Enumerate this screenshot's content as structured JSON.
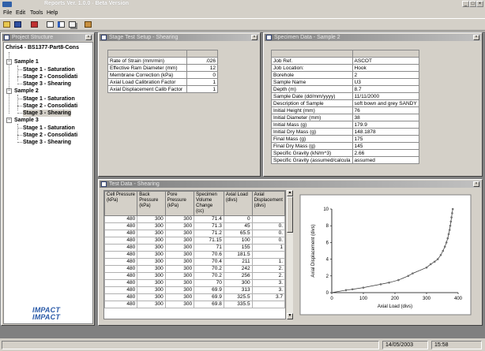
{
  "window": {
    "title": "Reports Ver. 1.0.0 - Beta Version",
    "min": "_",
    "max": "□",
    "close": "×"
  },
  "menu": [
    "File",
    "Edit",
    "Tools",
    "Help"
  ],
  "project": {
    "title": "Project Structure",
    "root": "Chris4 - BS1377-Part8-Cons",
    "samples": [
      {
        "label": "Sample 1",
        "stages": [
          "Stage 1 - Saturation",
          "Stage 2 - Consolidati",
          "Stage 3 - Shearing"
        ]
      },
      {
        "label": "Sample 2",
        "stages": [
          "Stage 1 - Saturation",
          "Stage 2 - Consolidati",
          "Stage 3 - Shearing"
        ]
      },
      {
        "label": "Sample 3",
        "stages": [
          "Stage 1 - Saturation",
          "Stage 2 - Consolidati",
          "Stage 3 - Shearing"
        ]
      }
    ],
    "logo": [
      "IMPACT",
      "IMPACT"
    ]
  },
  "setup": {
    "title": "Stage Test Setup - Shearing",
    "rows": [
      [
        "Rate of Strain (mm/min)",
        ".026"
      ],
      [
        "Effective Ram Diameter (mm)",
        "12"
      ],
      [
        "Membrane Correction (kPa)",
        "0"
      ],
      [
        "Axial Load Calibration Factor",
        "1"
      ],
      [
        "Axial Displacement Calib Factor",
        "1"
      ]
    ]
  },
  "specimen": {
    "title": "Specimen Data - Sample 2",
    "rows": [
      [
        "Job Ref.",
        "ASCOT"
      ],
      [
        "Job Location:",
        "Hook"
      ],
      [
        "Borehole",
        "2"
      ],
      [
        "Sample Name",
        "U3"
      ],
      [
        "Depth (m)",
        "8.7"
      ],
      [
        "Sample Date (dd/mm/yyyy)",
        "11/11/2000"
      ],
      [
        "Description of Sample",
        "soft bown and grey SANDY"
      ],
      [
        "Initial Height (mm)",
        "76"
      ],
      [
        "Initial Diameter (mm)",
        "38"
      ],
      [
        "Initial Mass (g)",
        "179.9"
      ],
      [
        "Initial Dry Mass (g)",
        "148.1878"
      ],
      [
        "Final Mass (g)",
        "175"
      ],
      [
        "Final Dry Mass (g)",
        "145"
      ],
      [
        "Specific Gravity (kN/m^3)",
        "2.66"
      ],
      [
        "Specific Gravity (assumed/calcula",
        "assumed"
      ]
    ]
  },
  "testdata": {
    "title": "Test Data - Shearing",
    "columns": [
      "Cell Pressure (kPa)",
      "Back Pressure (kPa)",
      "Pore Pressure (kPa)",
      "Specimen Volume Change (cc)",
      "Axial Load (divs)",
      "Axial Displacement (divs)"
    ],
    "rows": [
      [
        "480",
        "300",
        "300",
        "71.4",
        "0",
        ""
      ],
      [
        "480",
        "300",
        "300",
        "71.3",
        "45",
        "0."
      ],
      [
        "480",
        "300",
        "300",
        "71.2",
        "65.5",
        "0."
      ],
      [
        "480",
        "300",
        "300",
        "71.15",
        "100",
        "0."
      ],
      [
        "480",
        "300",
        "300",
        "71",
        "155",
        "1"
      ],
      [
        "480",
        "300",
        "300",
        "70.6",
        "181.5",
        ""
      ],
      [
        "480",
        "300",
        "300",
        "70.4",
        "211",
        "1."
      ],
      [
        "480",
        "300",
        "300",
        "70.2",
        "242",
        "2."
      ],
      [
        "480",
        "300",
        "300",
        "70.2",
        "256",
        "2."
      ],
      [
        "480",
        "300",
        "300",
        "70",
        "300",
        "3."
      ],
      [
        "480",
        "300",
        "300",
        "69.9",
        "313",
        "3."
      ],
      [
        "480",
        "300",
        "300",
        "69.9",
        "325.5",
        "3.7"
      ],
      [
        "480",
        "300",
        "300",
        "69.8",
        "335.5",
        ""
      ]
    ]
  },
  "chart_data": {
    "type": "scatter",
    "xlabel": "Axial Load (divs)",
    "ylabel": "Axial Displacement (divs)",
    "xlim": [
      0,
      400
    ],
    "ylim": [
      0,
      10
    ],
    "xticks": [
      "0",
      "100",
      "200",
      "300",
      "400"
    ],
    "yticks": [
      "0",
      "2",
      "4",
      "6",
      "8",
      "10"
    ],
    "line": true,
    "x": [
      0,
      45,
      65.5,
      100,
      155,
      181.5,
      211,
      242,
      256,
      300,
      313,
      325.5,
      335.5,
      345,
      352,
      358,
      363,
      367,
      370,
      373,
      375,
      377,
      379,
      381,
      383
    ],
    "y": [
      0,
      0.3,
      0.4,
      0.6,
      1.0,
      1.2,
      1.5,
      2.0,
      2.3,
      3.0,
      3.4,
      3.7,
      4.0,
      4.5,
      5.0,
      5.5,
      6.0,
      6.5,
      7.0,
      7.5,
      8.0,
      8.5,
      9.0,
      9.5,
      10.0
    ]
  },
  "status": {
    "date": "14/05/2003",
    "time": "15:58"
  }
}
